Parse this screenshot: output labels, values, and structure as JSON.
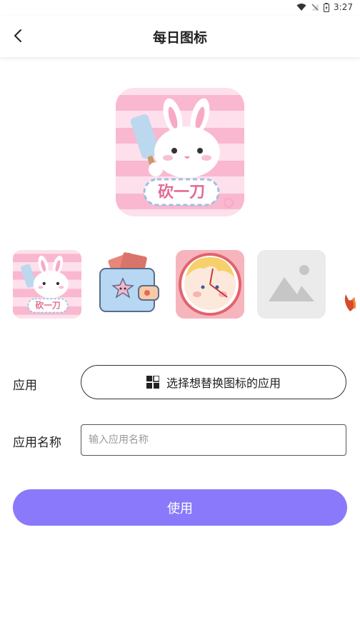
{
  "status_bar": {
    "time": "3:27"
  },
  "header": {
    "title": "每日图标"
  },
  "preview": {
    "badge_text": "砍一刀"
  },
  "thumbnails": [
    {
      "name": "bunny-knife",
      "badge_text": "砍一刀"
    },
    {
      "name": "wallet-star"
    },
    {
      "name": "clock-face"
    },
    {
      "name": "image-placeholder"
    },
    {
      "name": "partial-icon"
    }
  ],
  "form": {
    "app_label": "应用",
    "app_button_label": "选择想替换图标的应用",
    "name_label": "应用名称",
    "name_placeholder": "输入应用名称",
    "name_value": ""
  },
  "use_button_label": "使用",
  "colors": {
    "accent": "#8a79fb",
    "pink": "#f7a9c6",
    "light_pink": "#fde0ec"
  }
}
